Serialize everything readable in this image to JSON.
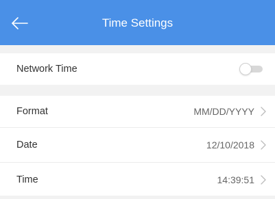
{
  "header": {
    "title": "Time Settings",
    "back_icon": "arrow-left-icon",
    "background_color": "#4a90e7"
  },
  "settings": {
    "network_time": {
      "label": "Network Time",
      "enabled": false
    },
    "format": {
      "label": "Format",
      "value": "MM/DD/YYYY"
    },
    "date": {
      "label": "Date",
      "value": "12/10/2018"
    },
    "time": {
      "label": "Time",
      "value": "14:39:51"
    }
  }
}
